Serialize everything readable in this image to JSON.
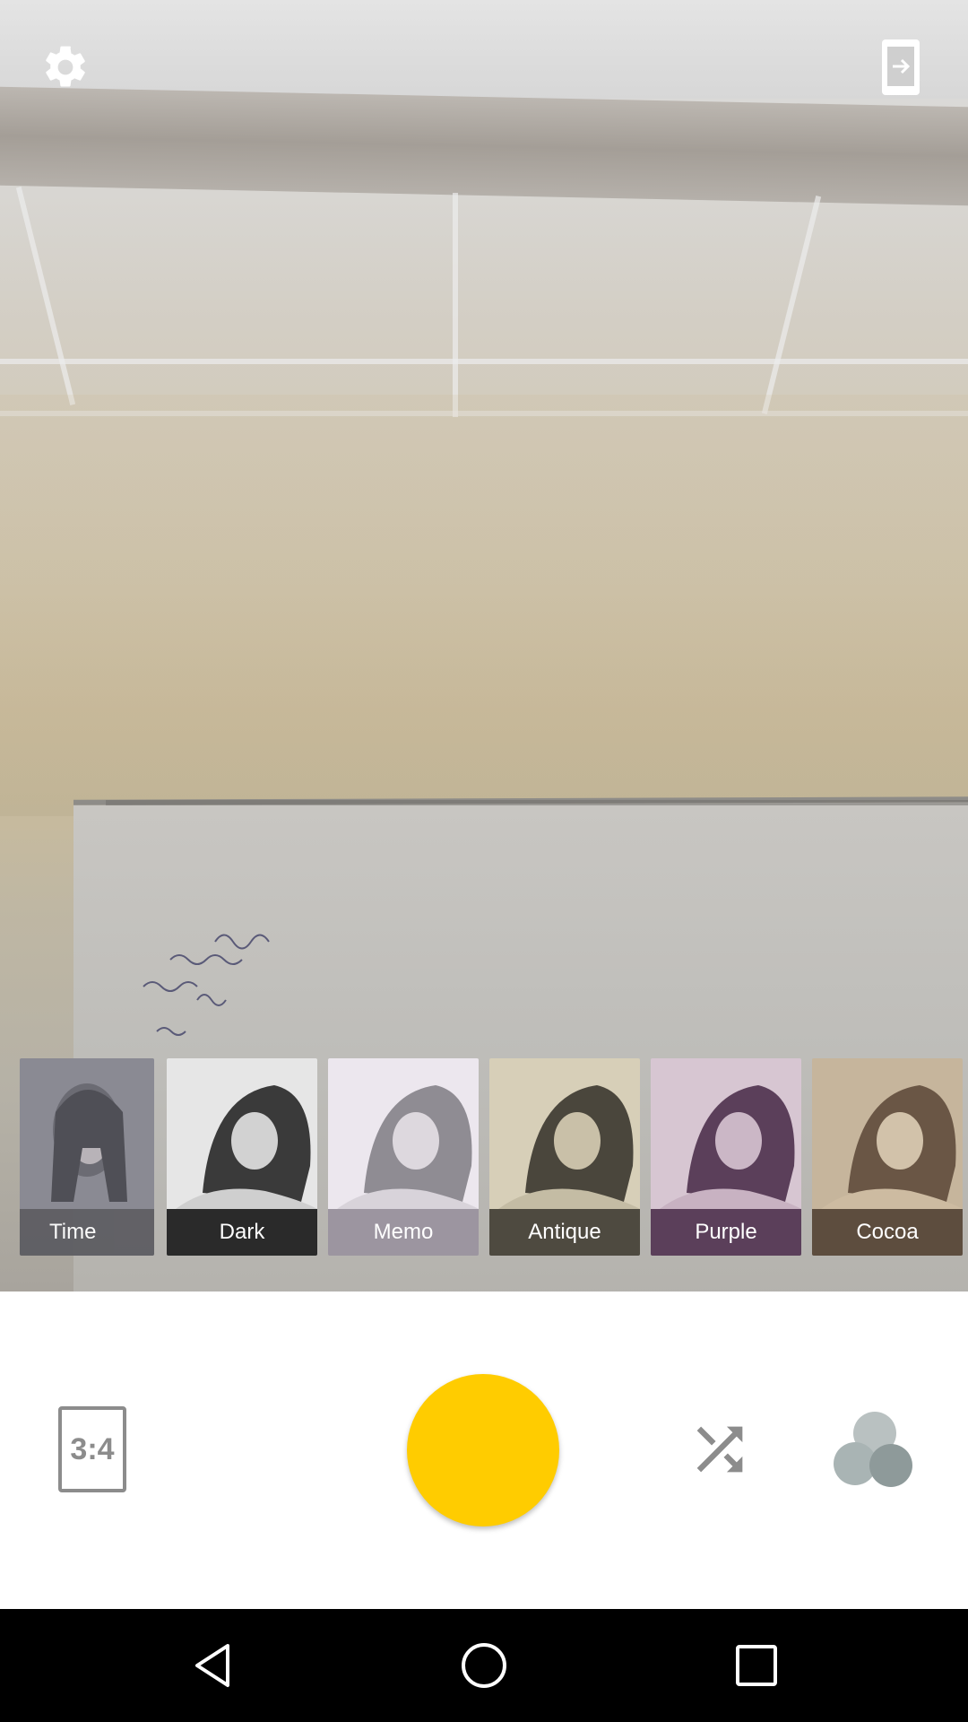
{
  "filters": [
    {
      "label": "Time",
      "label_bg": "#5d5d62",
      "tint": "#8a8a93"
    },
    {
      "label": "Dark",
      "label_bg": "#2a2a2a",
      "tint": "#e6e6e6"
    },
    {
      "label": "Memo",
      "label_bg": "#9c95a0",
      "tint": "#ece7ee"
    },
    {
      "label": "Antique",
      "label_bg": "#4e4a40",
      "tint": "#d7cfb8"
    },
    {
      "label": "Purple",
      "label_bg": "#5b3f5a",
      "tint": "#d7c6d2"
    },
    {
      "label": "Cocoa",
      "label_bg": "#5d4d3e",
      "tint": "#c6b59c"
    }
  ],
  "controls": {
    "aspect_ratio": "3:4",
    "shutter_color": "#ffcc00"
  },
  "icons": {
    "settings": "gear-icon",
    "switch_camera": "switch-camera-icon",
    "shuffle": "shuffle-icon",
    "effects": "overlapping-circles-icon",
    "nav_back": "back-triangle-icon",
    "nav_home": "home-circle-icon",
    "nav_recents": "recents-square-icon"
  }
}
